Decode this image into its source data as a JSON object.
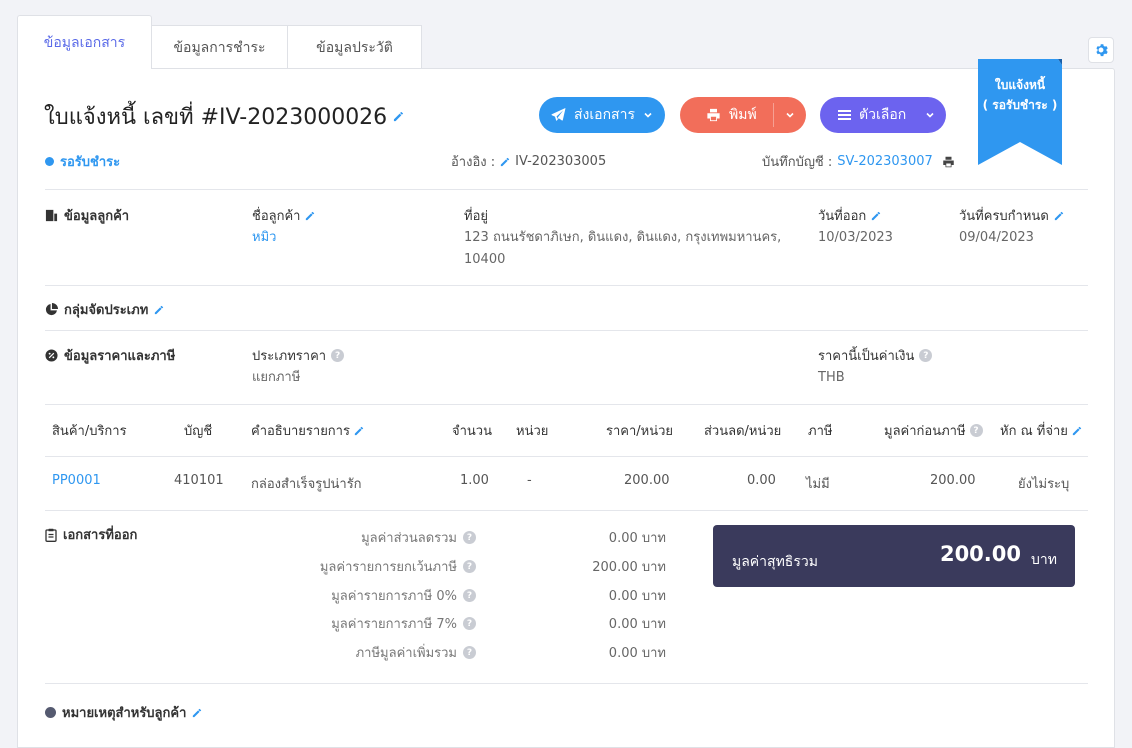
{
  "tabs": [
    "ข้อมูลเอกสาร",
    "ข้อมูลการชำระ",
    "ข้อมูลประวัติ"
  ],
  "header": {
    "title": "ใบแจ้งหนี้ เลขที่ #IV-2023000026",
    "status": "รอรับชำระ",
    "ref_label": "อ้างอิง :",
    "ref_value": "IV-202303005",
    "ledger_label": "บันทึกบัญชี :",
    "ledger_value": "SV-202303007"
  },
  "buttons": {
    "send": "ส่งเอกสาร",
    "print": "พิมพ์",
    "options": "ตัวเลือก"
  },
  "ribbon": {
    "line1": "ใบแจ้งหนี้",
    "line2": "( รอรับชำระ )",
    "color": "#2f97f0"
  },
  "customer": {
    "section": "ข้อมูลลูกค้า",
    "name_label": "ชื่อลูกค้า",
    "name": "หมิว",
    "address_label": "ที่อยู่",
    "address_line1": "123 ถนนรัชดาภิเษก, ดินแดง, ดินแดง, กรุงเทพมหานคร,",
    "address_line2": "10400",
    "issue_label": "วันที่ออก",
    "issue_date": "10/03/2023",
    "due_label": "วันที่ครบกำหนด",
    "due_date": "09/04/2023"
  },
  "category": {
    "section": "กลุ่มจัดประเภท"
  },
  "pricing": {
    "section": "ข้อมูลราคาและภาษี",
    "price_type_label": "ประเภทราคา",
    "price_type": "แยกภาษี",
    "currency_label": "ราคานี้เป็นค่าเงิน",
    "currency": "THB"
  },
  "table": {
    "headers": [
      "สินค้า/บริการ",
      "บัญชี",
      "คำอธิบายรายการ",
      "จำนวน",
      "หน่วย",
      "ราคา/หน่วย",
      "ส่วนลด/หน่วย",
      "ภาษี",
      "มูลค่าก่อนภาษี",
      "หัก ณ ที่จ่าย"
    ],
    "rows": [
      [
        "PP0001",
        "410101",
        "กล่องสำเร็จรูปน่ารัก",
        "1.00",
        "-",
        "200.00",
        "0.00",
        "ไม่มี",
        "200.00",
        "ยังไม่ระบุ"
      ]
    ]
  },
  "documents": {
    "section": "เอกสารที่ออก"
  },
  "summary": {
    "items": [
      {
        "label": "มูลค่าส่วนลดรวม",
        "value": "0.00 บาท"
      },
      {
        "label": "มูลค่ารายการยกเว้นภาษี",
        "value": "200.00 บาท"
      },
      {
        "label": "มูลค่ารายการภาษี 0%",
        "value": "0.00 บาท"
      },
      {
        "label": "มูลค่ารายการภาษี 7%",
        "value": "0.00 บาท"
      },
      {
        "label": "ภาษีมูลค่าเพิ่มรวม",
        "value": "0.00 บาท"
      }
    ],
    "net_label": "มูลค่าสุทธิรวม",
    "net_value": "200.00",
    "net_unit": "บาท"
  },
  "notes": {
    "section": "หมายเหตุสำหรับลูกค้า"
  },
  "icons": {
    "pencil": "pencil-icon",
    "gear": "gear-icon",
    "send": "paper-plane-icon",
    "print": "printer-icon",
    "options": "list-icon",
    "help": "question-icon"
  },
  "colors": {
    "primary": "#2f97f0",
    "print": "#f26e5a",
    "options": "#6c63ef",
    "net_box": "#3a3a5c",
    "active_tab": "#5b6be8"
  }
}
